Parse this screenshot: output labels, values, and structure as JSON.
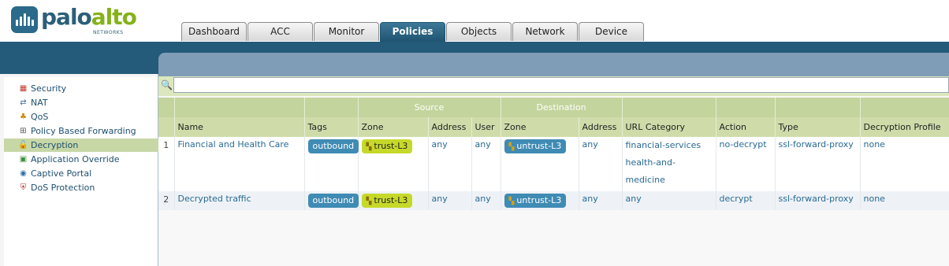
{
  "brand": {
    "name_part1": "palo",
    "name_part2": "alto",
    "sub": "NETWORKS"
  },
  "tabs": [
    {
      "label": "Dashboard",
      "active": false
    },
    {
      "label": "ACC",
      "active": false
    },
    {
      "label": "Monitor",
      "active": false
    },
    {
      "label": "Policies",
      "active": true
    },
    {
      "label": "Objects",
      "active": false
    },
    {
      "label": "Network",
      "active": false
    },
    {
      "label": "Device",
      "active": false
    }
  ],
  "sidebar": {
    "items": [
      {
        "label": "Security",
        "icon": "firewall-icon"
      },
      {
        "label": "NAT",
        "icon": "nat-icon"
      },
      {
        "label": "QoS",
        "icon": "qos-icon"
      },
      {
        "label": "Policy Based Forwarding",
        "icon": "pbf-icon"
      },
      {
        "label": "Decryption",
        "icon": "lock-icon",
        "active": true
      },
      {
        "label": "Application Override",
        "icon": "app-override-icon"
      },
      {
        "label": "Captive Portal",
        "icon": "captive-portal-icon"
      },
      {
        "label": "DoS Protection",
        "icon": "dos-shield-icon"
      }
    ]
  },
  "search": {
    "placeholder": "",
    "value": ""
  },
  "table": {
    "group_headers": {
      "source": "Source",
      "destination": "Destination"
    },
    "columns": [
      "Name",
      "Tags",
      "Zone",
      "Address",
      "User",
      "Zone",
      "Address",
      "URL Category",
      "Action",
      "Type",
      "Decryption Profile"
    ],
    "rows": [
      {
        "num": "1",
        "name": "Financial and Health Care",
        "tag": "outbound",
        "src_zone": "trust-L3",
        "src_address": "any",
        "src_user": "any",
        "dst_zone": "untrust-L3",
        "dst_address": "any",
        "url_category": [
          "financial-services",
          "health-and-medicine"
        ],
        "action": "no-decrypt",
        "type": "ssl-forward-proxy",
        "profile": "none"
      },
      {
        "num": "2",
        "name": "Decrypted traffic",
        "tag": "outbound",
        "src_zone": "trust-L3",
        "src_address": "any",
        "src_user": "any",
        "dst_zone": "untrust-L3",
        "dst_address": "any",
        "url_category": [
          "any"
        ],
        "action": "decrypt",
        "type": "ssl-forward-proxy",
        "profile": "none"
      }
    ]
  },
  "colors": {
    "accent": "#245a7a",
    "brand_green": "#84b21a",
    "header_green": "#c3d49d",
    "tag_blue": "#3f8bb4",
    "zone_yellow": "#c6d92a"
  }
}
